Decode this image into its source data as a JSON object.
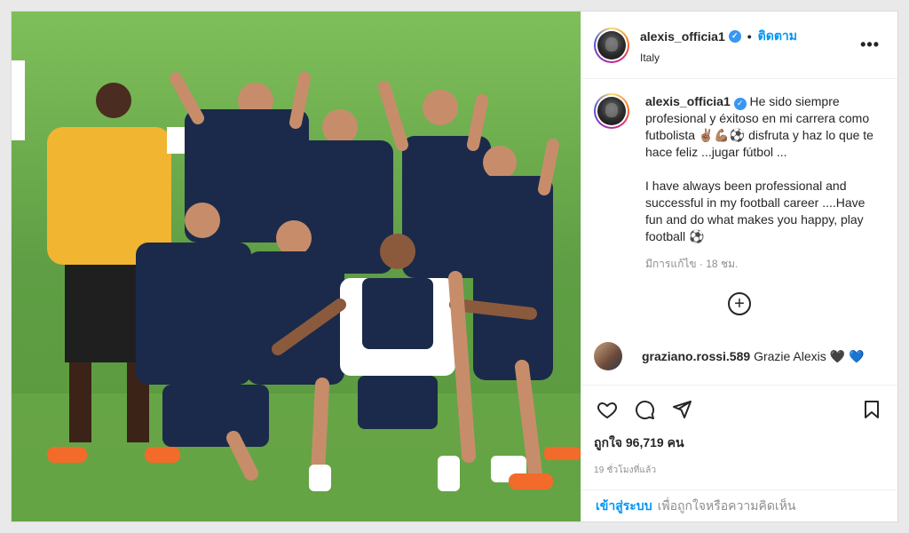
{
  "post": {
    "photo_alt": "Team photo on training pitch",
    "header": {
      "username": "alexis_officia1",
      "verified": true,
      "follow_label": "ติดตาม",
      "location": "Italy",
      "more_icon": "more-horizontal-icon"
    },
    "caption": {
      "username": "alexis_officia1",
      "text_es": "He sido siempre profesional y éxitoso en mi carrera como futbolista ✌🏽💪🏽⚽ disfruta y haz lo que te hace feliz ...jugar fútbol ...",
      "text_en": "I have always been professional and successful in my football career ....Have fun and do what makes you happy, play football ⚽",
      "edited": "มีการแก้ไข · 18 ชม."
    },
    "add_comment_icon": "plus-circle-icon",
    "comments": [
      {
        "username": "graziano.rossi.589",
        "text": "Grazie Alexis",
        "emoji1": "🖤",
        "emoji2": "💙"
      }
    ],
    "actions": {
      "like_icon": "heart-icon",
      "comment_icon": "comment-icon",
      "share_icon": "share-icon",
      "save_icon": "bookmark-icon"
    },
    "likes": "ถูกใจ 96,719 คน",
    "time": "19 ชั่วโมงที่แล้ว",
    "login": {
      "link": "เข้าสู่ระบบ",
      "text": "เพื่อถูกใจหรือความคิดเห็น"
    }
  },
  "colors": {
    "accent": "#0095f6",
    "verified": "#3897f0",
    "grass": "#6aa84f",
    "kit_navy": "#1b2a4a",
    "gk_yellow": "#f2b531"
  }
}
